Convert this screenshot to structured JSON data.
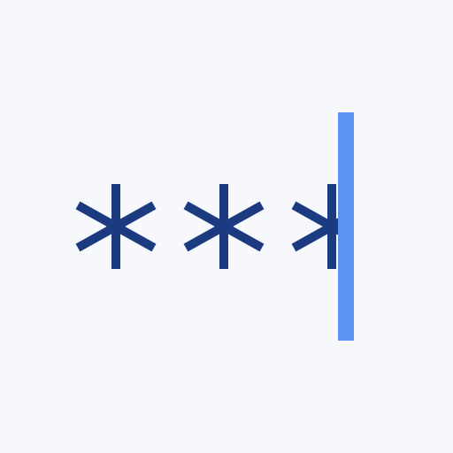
{
  "password_field": {
    "masked_char_count": 3,
    "mask_glyph": "asterisk-icon",
    "caret": "text-caret"
  },
  "colors": {
    "background": "#f6f8fc",
    "mask_glyph": "#1c3a80",
    "caret": "#5b93f5"
  }
}
